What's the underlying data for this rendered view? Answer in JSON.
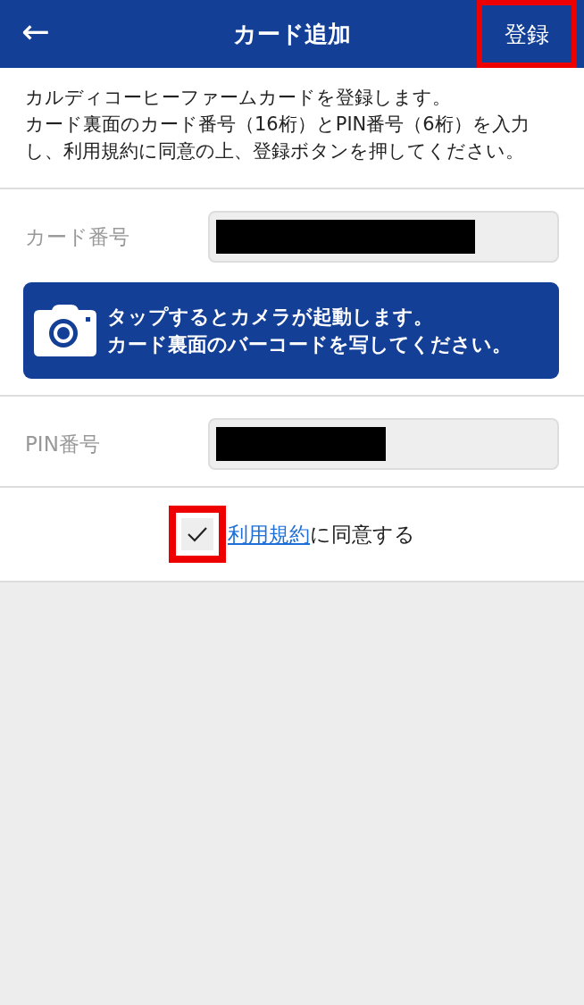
{
  "header": {
    "back": "←",
    "title": "カード追加",
    "register_button": {
      "label": "登録",
      "highlighted": true
    }
  },
  "intro": [
    "カルディコーヒーファームカードを登録します。",
    "カード裏面のカード番号（16桁）とPIN番号（6桁）を入力し、利用規約に同意の上、登録ボタンを押してください。"
  ],
  "card_number": {
    "label": "カード番号",
    "redacted": true
  },
  "camera_button": {
    "lines": [
      "タップするとカメラが起動します。",
      "カード裏面のバーコードを写してください。"
    ]
  },
  "pin": {
    "label": "PIN番号",
    "redacted": true
  },
  "agreement": {
    "checked": true,
    "highlighted": true,
    "link": "利用規約",
    "text": "に同意する"
  }
}
